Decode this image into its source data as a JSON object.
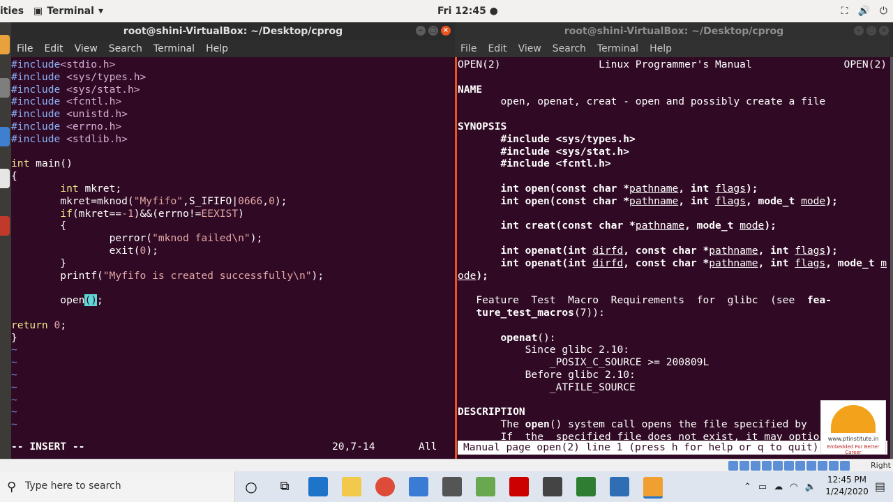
{
  "topbar": {
    "activities": "ities",
    "app_name": "Terminal",
    "clock": "Fri 12:45 ●",
    "tray": [
      "⛶",
      "🔊",
      "⏻"
    ]
  },
  "left_window": {
    "title": "root@shini-VirtualBox: ~/Desktop/cprog",
    "menu": [
      "File",
      "Edit",
      "View",
      "Search",
      "Terminal",
      "Help"
    ],
    "status_mode": "-- INSERT --",
    "status_position": "20,7-14",
    "status_percent": "All"
  },
  "right_window": {
    "title": "root@shini-VirtualBox: ~/Desktop/cprog",
    "menu": [
      "File",
      "Edit",
      "View",
      "Search",
      "Terminal",
      "Help"
    ],
    "status_line": "Manual page open(2) line 1 (press h for help or q to quit)"
  },
  "logo": {
    "url_text": "www.ptinstitute.in",
    "tagline": "Embedded For Better Career"
  },
  "vbox_strip": {
    "host_key": "Right"
  },
  "taskbar": {
    "search_placeholder": "Type here to search",
    "time": "12:45 PM",
    "date": "1/24/2020"
  }
}
